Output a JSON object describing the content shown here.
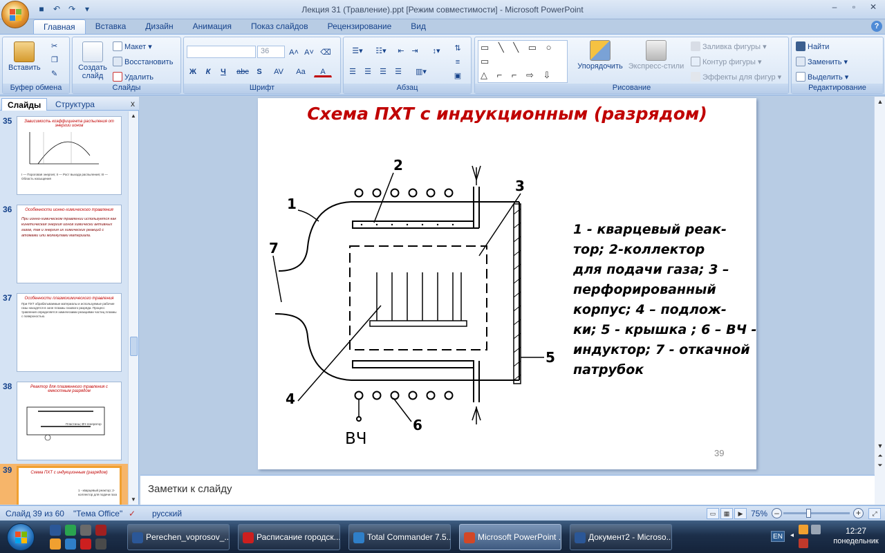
{
  "window": {
    "title": "Лекция 31 (Травление).ppt [Режим совместимости] - Microsoft PowerPoint"
  },
  "ribbon": {
    "tabs": [
      "Главная",
      "Вставка",
      "Дизайн",
      "Анимация",
      "Показ слайдов",
      "Рецензирование",
      "Вид"
    ],
    "clipboard": {
      "paste": "Вставить",
      "label": "Буфер обмена"
    },
    "slides": {
      "new_slide": "Создать слайд",
      "layout": "Макет",
      "reset": "Восстановить",
      "delete": "Удалить",
      "label": "Слайды"
    },
    "font": {
      "font_size": "36",
      "label": "Шрифт",
      "bold": "Ж",
      "italic": "К",
      "underline": "Ч",
      "strike": "abc",
      "shadow": "S",
      "spacing": "AV",
      "case": "Aa",
      "color": "A"
    },
    "paragraph": {
      "label": "Абзац"
    },
    "drawing": {
      "arrange": "Упорядочить",
      "quick_styles": "Экспресс-стили",
      "fill": "Заливка фигуры",
      "outline": "Контур фигуры",
      "effects": "Эффекты для фигур",
      "label": "Рисование"
    },
    "editing": {
      "find": "Найти",
      "replace": "Заменить",
      "select": "Выделить",
      "label": "Редактирование"
    }
  },
  "left_pane": {
    "tabs": [
      "Слайды",
      "Структура"
    ],
    "close": "x",
    "thumbnails": [
      {
        "num": "35",
        "title": "Зависимость коэффициента распыления от энергии ионов",
        "text": "I — Пороговая энергия; II — Рост выхода распыления; III — Область насыщения",
        "selected": false
      },
      {
        "num": "36",
        "title": "Особенности ионно-химического травления",
        "text": "При ионно-химическом травлении используется как кинетическая энергия ионов химически активных газов, так и энергия их химических реакций с атомами или молекулами материала.",
        "selected": false
      },
      {
        "num": "37",
        "title": "Особенности плазмохимического травления",
        "text": "При ПХТ обрабатываемые материалы и используемые рабочие газы находятся в зоне плазмы газового разряда. Процесс травления определяется химическими реакциями частиц плазмы с поверхностью.",
        "selected": false
      },
      {
        "num": "38",
        "title": "Реактор для плазменного травления с емкостным разрядом",
        "text": "Пластины; ВЧ-генератор",
        "selected": false
      },
      {
        "num": "39",
        "title": "Схема ПХТ с индукционным (разрядом)",
        "text": "1 - кварцевый реактор; 2-коллектор для подачи газа",
        "selected": true
      }
    ]
  },
  "slide": {
    "title": "Схема ПХТ с индукционным (разрядом)",
    "legend_lines": [
      "1 - кварцевый реак-",
      "тор;  2-коллектор",
      "для подачи газа; 3 –",
      "перфорированный",
      "корпус; 4 – подлож-",
      "ки; 5 - крышка ; 6 – ВЧ -",
      "индуктор; 7 - откачной",
      "патрубок"
    ],
    "diagram_labels": {
      "l1": "1",
      "l2": "2",
      "l3": "3",
      "l4": "4",
      "l5": "5",
      "l6": "6",
      "l7": "7",
      "rf": "ВЧ"
    },
    "page_number": "39"
  },
  "notes": {
    "placeholder": "Заметки к слайду"
  },
  "status_bar": {
    "slide_info": "Слайд 39 из 60",
    "theme": "\"Тема Office\"",
    "language": "русский",
    "zoom": "75%"
  },
  "taskbar": {
    "items": [
      {
        "label": "Perechen_voprosov_...",
        "icon_color": "#2b5797",
        "active": false
      },
      {
        "label": "Расписание городск...",
        "icon_color": "#cc1f1f",
        "active": false
      },
      {
        "label": "Total Commander 7.5...",
        "icon_color": "#2f7fc8",
        "active": false
      },
      {
        "label": "Microsoft PowerPoint ...",
        "icon_color": "#d24726",
        "active": true
      },
      {
        "label": "Документ2 - Microso...",
        "icon_color": "#2b5797",
        "active": false
      }
    ],
    "language": "EN",
    "clock_time": "12:27",
    "clock_day": "понедельник"
  }
}
